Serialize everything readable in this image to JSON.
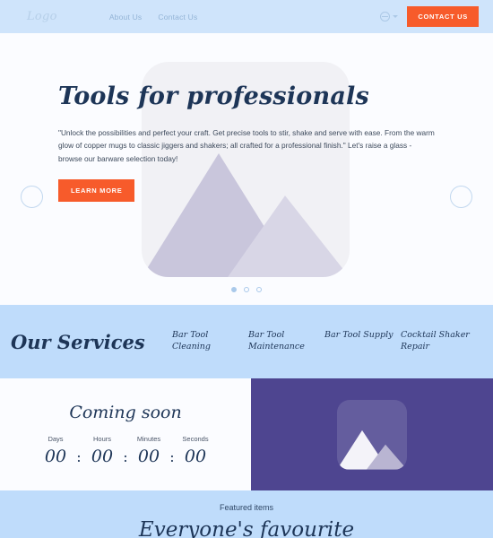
{
  "header": {
    "logo": "Logo",
    "nav": [
      {
        "label": "About Us"
      },
      {
        "label": "Contact Us"
      }
    ],
    "lang_icon": "globe-icon",
    "contact_button": "CONTACT US"
  },
  "hero": {
    "title": "Tools for professionals",
    "paragraph": "\"Unlock the possibilities and perfect your craft. Get precise tools to stir, shake and serve with ease. From the warm glow of copper mugs to classic jiggers and shakers; all crafted for a professional finish.\" Let's raise a glass - browse our barware selection today!",
    "cta": "LEARN MORE",
    "image_placeholder": "image-placeholder-icon",
    "carousel": {
      "prev": "previous-slide",
      "next": "next-slide",
      "dots": 3,
      "active_dot": 0
    }
  },
  "services": {
    "title": "Our Services",
    "items": [
      {
        "label": "Bar Tool Cleaning"
      },
      {
        "label": "Bar Tool Maintenance"
      },
      {
        "label": "Bar Tool Supply"
      },
      {
        "label": "Cocktail Shaker Repair"
      }
    ]
  },
  "countdown": {
    "heading": "Coming soon",
    "labels": [
      "Days",
      "Hours",
      "Minutes",
      "Seconds"
    ],
    "values": [
      "00",
      "00",
      "00",
      "00"
    ],
    "separator": ":",
    "image_placeholder": "image-placeholder-icon"
  },
  "featured": {
    "eyebrow": "Featured items",
    "title": "Everyone's favourite"
  },
  "colors": {
    "accent": "#f75b2b",
    "header_bg": "#cfe4fb",
    "services_bg": "#bfdcfb",
    "purple": "#4e4590",
    "heading": "#1d3557"
  }
}
